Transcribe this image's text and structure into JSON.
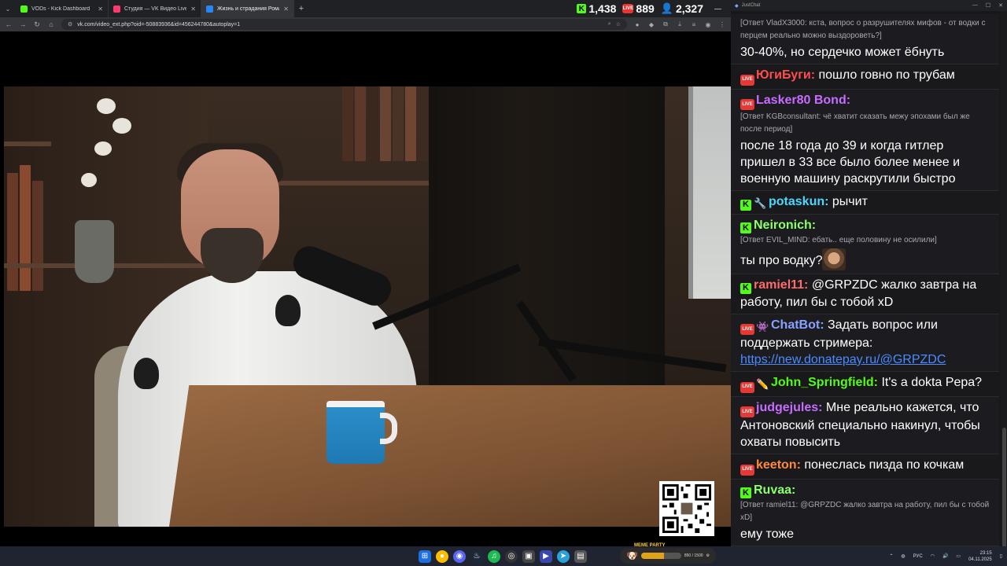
{
  "browser": {
    "tabs": [
      {
        "title": "VODs - Kick Dashboard",
        "color": "#53fc18",
        "active": false
      },
      {
        "title": "Студия — VK Видео Live",
        "color": "#ff3b6b",
        "active": false
      },
      {
        "title": "Жизнь и страдания Роман…",
        "color": "#2787f5",
        "active": true
      }
    ],
    "url": "vk.com/video_ext.php?oid=-50883936&id=456244780&autoplay=1"
  },
  "stats": {
    "kick_viewers": "1,438",
    "vk_viewers": "889",
    "total_viewers": "2,327"
  },
  "chat": {
    "window_title": "JustChat",
    "messages": [
      {
        "id": "m1",
        "reply": "[Ответ VladX3000: кста, вопрос о разрушителях мифов - от водки с перцем реально можно выздороветь?]",
        "text": "30-40%, но сердечко может ёбнуть"
      },
      {
        "id": "m2",
        "platform": "live",
        "nick": "ЮгиБуги:",
        "nick_color": "#ff4d4d",
        "text": "пошло говно по трубам"
      },
      {
        "id": "m3",
        "platform": "live",
        "nick": "Lasker80 Bond:",
        "nick_color": "#c86bff",
        "reply": "[Ответ KGBconsultant: чё хватит сказать межу эпохами был же после период]",
        "text": "после 18 года до 39 и когда гитлер пришел в 33 все было более менее и военную машину раскрутили быстро"
      },
      {
        "id": "m4",
        "platform": "kick",
        "badge": "🔧",
        "nick": "potaskun:",
        "nick_color": "#4bd8ff",
        "text": "рычит"
      },
      {
        "id": "m5",
        "platform": "kick",
        "nick": "Neironich:",
        "nick_color": "#8cff6b",
        "reply": "[Ответ EVIL_MIND: ебать.. еще половину не осилили]",
        "text": "ты про водку?"
      },
      {
        "id": "m6",
        "platform": "kick",
        "nick": "ramiel11:",
        "nick_color": "#ff6b6b",
        "text": "@GRPZDC жалко завтра на работу, пил бы с тобой xD"
      },
      {
        "id": "m7",
        "platform": "live",
        "badge": "👾",
        "nick": "ChatBot:",
        "nick_color": "#8aa2ff",
        "text": "Задать вопрос или поддержать стримера:",
        "link": "https://new.donatepay.ru/@GRPZDC"
      },
      {
        "id": "m8",
        "platform": "live",
        "badge": "✏️",
        "nick": "John_Springfield:",
        "nick_color": "#53fc18",
        "text": "It's a dokta Pepa?"
      },
      {
        "id": "m9",
        "platform": "live",
        "nick": "judgejules:",
        "nick_color": "#c86bff",
        "text": "Мне реально кажется, что Антоновский специально накинул, чтобы охваты повысить"
      },
      {
        "id": "m10",
        "platform": "live",
        "nick": "keeton:",
        "nick_color": "#ff8a3d",
        "text": "понеслась пизда по кочкам"
      },
      {
        "id": "m11",
        "platform": "kick",
        "nick": "Ruvaa:",
        "nick_color": "#8cff6b",
        "reply": "[Ответ ramiel11: @GRPZDC жалко завтра на работу, пил бы с тобой xD]",
        "text": "ему тоже"
      }
    ]
  },
  "taskbar": {
    "meme_party_label": "MEME PARTY",
    "meme_party_progress": "850 / 1500",
    "meme_fraction": 0.567,
    "lang": "РУС",
    "time": "23:15",
    "date": "04.11.2025"
  },
  "labels": {
    "live": "LIVE",
    "kick": "K"
  }
}
